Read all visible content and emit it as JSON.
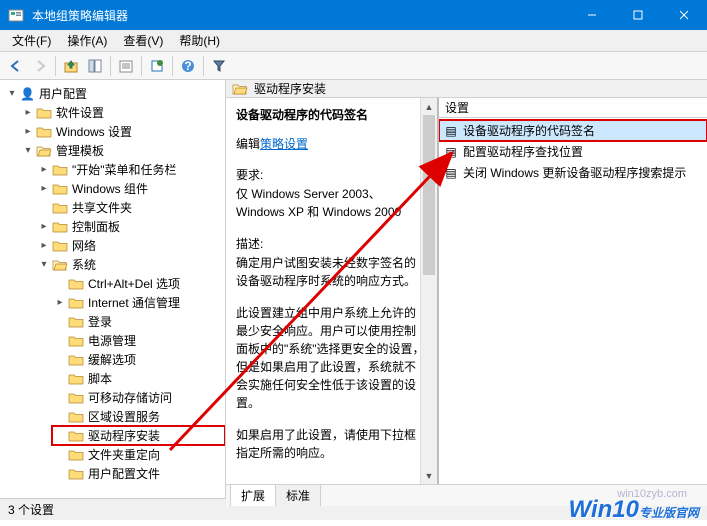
{
  "window": {
    "title": "本地组策略编辑器"
  },
  "menubar": [
    {
      "label": "文件(F)"
    },
    {
      "label": "操作(A)"
    },
    {
      "label": "查看(V)"
    },
    {
      "label": "帮助(H)"
    }
  ],
  "tree": {
    "root": "用户配置",
    "items": [
      {
        "label": "软件设置",
        "exp": "closed",
        "depth": 1,
        "open": false
      },
      {
        "label": "Windows 设置",
        "exp": "closed",
        "depth": 1,
        "open": false
      },
      {
        "label": "管理模板",
        "exp": "open",
        "depth": 1,
        "open": true
      },
      {
        "label": "\"开始\"菜单和任务栏",
        "exp": "closed",
        "depth": 2,
        "open": false
      },
      {
        "label": "Windows 组件",
        "exp": "closed",
        "depth": 2,
        "open": false
      },
      {
        "label": "共享文件夹",
        "exp": "none",
        "depth": 2,
        "open": false
      },
      {
        "label": "控制面板",
        "exp": "closed",
        "depth": 2,
        "open": false
      },
      {
        "label": "网络",
        "exp": "closed",
        "depth": 2,
        "open": false
      },
      {
        "label": "系统",
        "exp": "open",
        "depth": 2,
        "open": true
      },
      {
        "label": "Ctrl+Alt+Del 选项",
        "exp": "none",
        "depth": 3,
        "open": false
      },
      {
        "label": "Internet 通信管理",
        "exp": "closed",
        "depth": 3,
        "open": false
      },
      {
        "label": "登录",
        "exp": "none",
        "depth": 3,
        "open": false
      },
      {
        "label": "电源管理",
        "exp": "none",
        "depth": 3,
        "open": false
      },
      {
        "label": "缓解选项",
        "exp": "none",
        "depth": 3,
        "open": false
      },
      {
        "label": "脚本",
        "exp": "none",
        "depth": 3,
        "open": false
      },
      {
        "label": "可移动存储访问",
        "exp": "none",
        "depth": 3,
        "open": false
      },
      {
        "label": "区域设置服务",
        "exp": "none",
        "depth": 3,
        "open": false
      },
      {
        "label": "驱动程序安装",
        "exp": "none",
        "depth": 3,
        "open": false,
        "selected": true
      },
      {
        "label": "文件夹重定向",
        "exp": "none",
        "depth": 3,
        "open": false
      },
      {
        "label": "用户配置文件",
        "exp": "none",
        "depth": 3,
        "open": false
      }
    ]
  },
  "right": {
    "header": "驱动程序安装",
    "detail": {
      "title": "设备驱动程序的代码签名",
      "edit_prefix": "编辑",
      "edit_link": "策略设置",
      "req_label": "要求:",
      "req_text": "仅 Windows Server 2003、Windows XP 和 Windows 2000",
      "desc_label": "描述:",
      "desc_p1": "确定用户试图安装未经数字签名的设备驱动程序时系统的响应方式。",
      "desc_p2": "此设置建立组中用户系统上允许的最少安全响应。用户可以使用控制面板中的\"系统\"选择更安全的设置，但是如果启用了此设置，系统就不会实施任何安全性低于该设置的设置。",
      "desc_p3": "如果启用了此设置，请使用下拉框指定所需的响应。"
    },
    "list": {
      "col": "设置",
      "items": [
        {
          "label": "设备驱动程序的代码签名",
          "selected": true
        },
        {
          "label": "配置驱动程序查找位置",
          "selected": false
        },
        {
          "label": "关闭 Windows 更新设备驱动程序搜索提示",
          "selected": false
        }
      ]
    },
    "tabs": {
      "extended": "扩展",
      "standard": "标准"
    }
  },
  "status": "3 个设置",
  "watermark": {
    "brand": "Win10",
    "suffix": "专业版官网",
    "url": "win10zyb.com"
  }
}
